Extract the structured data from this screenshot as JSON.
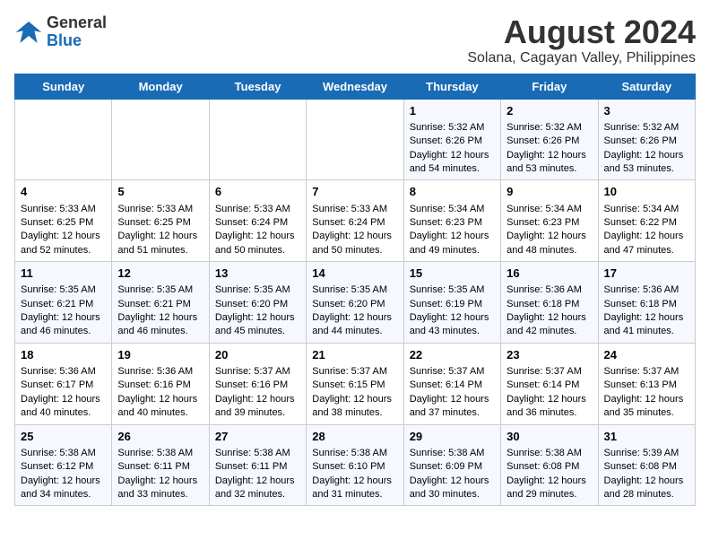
{
  "header": {
    "logo_line1": "General",
    "logo_line2": "Blue",
    "title": "August 2024",
    "subtitle": "Solana, Cagayan Valley, Philippines"
  },
  "weekdays": [
    "Sunday",
    "Monday",
    "Tuesday",
    "Wednesday",
    "Thursday",
    "Friday",
    "Saturday"
  ],
  "weeks": [
    [
      {
        "day": "",
        "sunrise": "",
        "sunset": "",
        "daylight": ""
      },
      {
        "day": "",
        "sunrise": "",
        "sunset": "",
        "daylight": ""
      },
      {
        "day": "",
        "sunrise": "",
        "sunset": "",
        "daylight": ""
      },
      {
        "day": "",
        "sunrise": "",
        "sunset": "",
        "daylight": ""
      },
      {
        "day": "1",
        "sunrise": "Sunrise: 5:32 AM",
        "sunset": "Sunset: 6:26 PM",
        "daylight": "Daylight: 12 hours and 54 minutes."
      },
      {
        "day": "2",
        "sunrise": "Sunrise: 5:32 AM",
        "sunset": "Sunset: 6:26 PM",
        "daylight": "Daylight: 12 hours and 53 minutes."
      },
      {
        "day": "3",
        "sunrise": "Sunrise: 5:32 AM",
        "sunset": "Sunset: 6:26 PM",
        "daylight": "Daylight: 12 hours and 53 minutes."
      }
    ],
    [
      {
        "day": "4",
        "sunrise": "Sunrise: 5:33 AM",
        "sunset": "Sunset: 6:25 PM",
        "daylight": "Daylight: 12 hours and 52 minutes."
      },
      {
        "day": "5",
        "sunrise": "Sunrise: 5:33 AM",
        "sunset": "Sunset: 6:25 PM",
        "daylight": "Daylight: 12 hours and 51 minutes."
      },
      {
        "day": "6",
        "sunrise": "Sunrise: 5:33 AM",
        "sunset": "Sunset: 6:24 PM",
        "daylight": "Daylight: 12 hours and 50 minutes."
      },
      {
        "day": "7",
        "sunrise": "Sunrise: 5:33 AM",
        "sunset": "Sunset: 6:24 PM",
        "daylight": "Daylight: 12 hours and 50 minutes."
      },
      {
        "day": "8",
        "sunrise": "Sunrise: 5:34 AM",
        "sunset": "Sunset: 6:23 PM",
        "daylight": "Daylight: 12 hours and 49 minutes."
      },
      {
        "day": "9",
        "sunrise": "Sunrise: 5:34 AM",
        "sunset": "Sunset: 6:23 PM",
        "daylight": "Daylight: 12 hours and 48 minutes."
      },
      {
        "day": "10",
        "sunrise": "Sunrise: 5:34 AM",
        "sunset": "Sunset: 6:22 PM",
        "daylight": "Daylight: 12 hours and 47 minutes."
      }
    ],
    [
      {
        "day": "11",
        "sunrise": "Sunrise: 5:35 AM",
        "sunset": "Sunset: 6:21 PM",
        "daylight": "Daylight: 12 hours and 46 minutes."
      },
      {
        "day": "12",
        "sunrise": "Sunrise: 5:35 AM",
        "sunset": "Sunset: 6:21 PM",
        "daylight": "Daylight: 12 hours and 46 minutes."
      },
      {
        "day": "13",
        "sunrise": "Sunrise: 5:35 AM",
        "sunset": "Sunset: 6:20 PM",
        "daylight": "Daylight: 12 hours and 45 minutes."
      },
      {
        "day": "14",
        "sunrise": "Sunrise: 5:35 AM",
        "sunset": "Sunset: 6:20 PM",
        "daylight": "Daylight: 12 hours and 44 minutes."
      },
      {
        "day": "15",
        "sunrise": "Sunrise: 5:35 AM",
        "sunset": "Sunset: 6:19 PM",
        "daylight": "Daylight: 12 hours and 43 minutes."
      },
      {
        "day": "16",
        "sunrise": "Sunrise: 5:36 AM",
        "sunset": "Sunset: 6:18 PM",
        "daylight": "Daylight: 12 hours and 42 minutes."
      },
      {
        "day": "17",
        "sunrise": "Sunrise: 5:36 AM",
        "sunset": "Sunset: 6:18 PM",
        "daylight": "Daylight: 12 hours and 41 minutes."
      }
    ],
    [
      {
        "day": "18",
        "sunrise": "Sunrise: 5:36 AM",
        "sunset": "Sunset: 6:17 PM",
        "daylight": "Daylight: 12 hours and 40 minutes."
      },
      {
        "day": "19",
        "sunrise": "Sunrise: 5:36 AM",
        "sunset": "Sunset: 6:16 PM",
        "daylight": "Daylight: 12 hours and 40 minutes."
      },
      {
        "day": "20",
        "sunrise": "Sunrise: 5:37 AM",
        "sunset": "Sunset: 6:16 PM",
        "daylight": "Daylight: 12 hours and 39 minutes."
      },
      {
        "day": "21",
        "sunrise": "Sunrise: 5:37 AM",
        "sunset": "Sunset: 6:15 PM",
        "daylight": "Daylight: 12 hours and 38 minutes."
      },
      {
        "day": "22",
        "sunrise": "Sunrise: 5:37 AM",
        "sunset": "Sunset: 6:14 PM",
        "daylight": "Daylight: 12 hours and 37 minutes."
      },
      {
        "day": "23",
        "sunrise": "Sunrise: 5:37 AM",
        "sunset": "Sunset: 6:14 PM",
        "daylight": "Daylight: 12 hours and 36 minutes."
      },
      {
        "day": "24",
        "sunrise": "Sunrise: 5:37 AM",
        "sunset": "Sunset: 6:13 PM",
        "daylight": "Daylight: 12 hours and 35 minutes."
      }
    ],
    [
      {
        "day": "25",
        "sunrise": "Sunrise: 5:38 AM",
        "sunset": "Sunset: 6:12 PM",
        "daylight": "Daylight: 12 hours and 34 minutes."
      },
      {
        "day": "26",
        "sunrise": "Sunrise: 5:38 AM",
        "sunset": "Sunset: 6:11 PM",
        "daylight": "Daylight: 12 hours and 33 minutes."
      },
      {
        "day": "27",
        "sunrise": "Sunrise: 5:38 AM",
        "sunset": "Sunset: 6:11 PM",
        "daylight": "Daylight: 12 hours and 32 minutes."
      },
      {
        "day": "28",
        "sunrise": "Sunrise: 5:38 AM",
        "sunset": "Sunset: 6:10 PM",
        "daylight": "Daylight: 12 hours and 31 minutes."
      },
      {
        "day": "29",
        "sunrise": "Sunrise: 5:38 AM",
        "sunset": "Sunset: 6:09 PM",
        "daylight": "Daylight: 12 hours and 30 minutes."
      },
      {
        "day": "30",
        "sunrise": "Sunrise: 5:38 AM",
        "sunset": "Sunset: 6:08 PM",
        "daylight": "Daylight: 12 hours and 29 minutes."
      },
      {
        "day": "31",
        "sunrise": "Sunrise: 5:39 AM",
        "sunset": "Sunset: 6:08 PM",
        "daylight": "Daylight: 12 hours and 28 minutes."
      }
    ]
  ]
}
